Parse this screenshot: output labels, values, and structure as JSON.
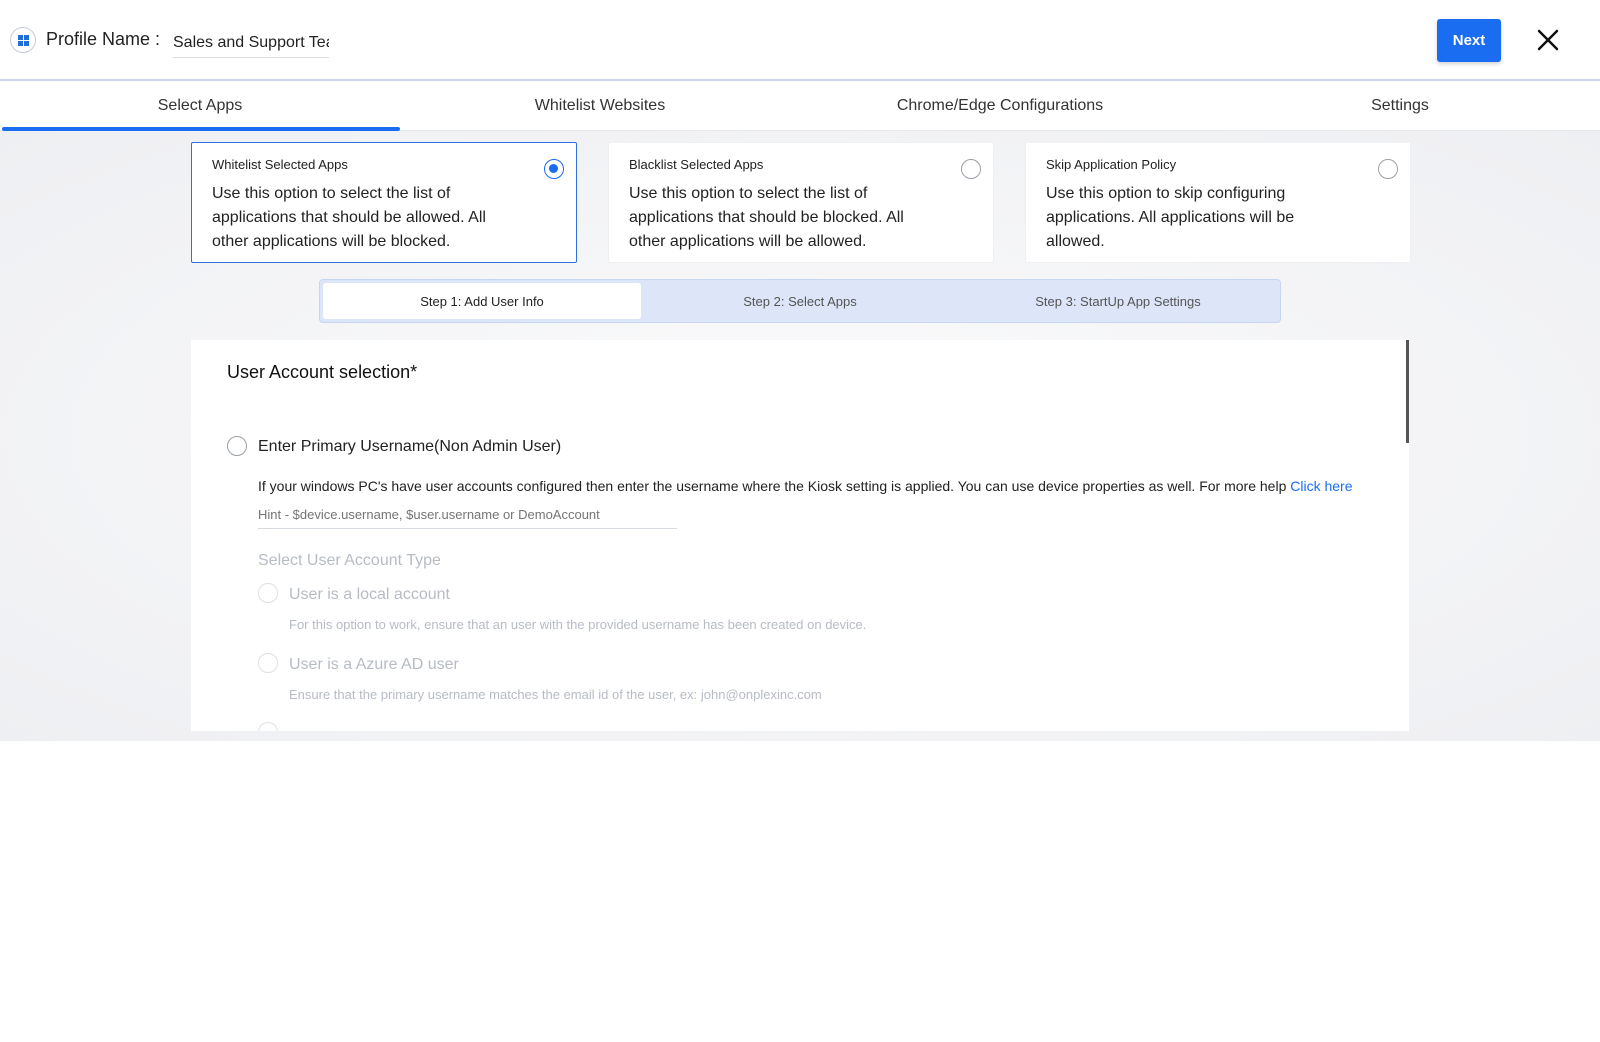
{
  "header": {
    "profile_label": "Profile Name :",
    "profile_value": "Sales and Support Tea",
    "next_label": "Next"
  },
  "tabs": [
    {
      "label": "Select Apps",
      "active": true
    },
    {
      "label": "Whitelist Websites",
      "active": false
    },
    {
      "label": "Chrome/Edge Configurations",
      "active": false
    },
    {
      "label": "Settings",
      "active": false
    }
  ],
  "policy_options": [
    {
      "title": "Whitelist Selected Apps",
      "desc": "Use this option to select the list of applications that should be allowed. All other applications will be blocked.",
      "selected": true
    },
    {
      "title": "Blacklist Selected Apps",
      "desc": "Use this option to select the list of applications that should be blocked. All other applications will be allowed.",
      "selected": false
    },
    {
      "title": "Skip Application Policy",
      "desc": "Use this option to skip configuring applications. All applications will be allowed.",
      "selected": false
    }
  ],
  "steps": [
    {
      "label": "Step 1: Add User Info",
      "active": true
    },
    {
      "label": "Step 2: Select Apps",
      "active": false
    },
    {
      "label": "Step 3: StartUp App Settings",
      "active": false
    }
  ],
  "form": {
    "section_title": "User Account selection*",
    "primary_option_label": "Enter Primary Username(Non Admin User)",
    "primary_help": "If your windows PC's have user accounts configured then enter the username where the Kiosk setting is applied. You can use device properties as well. For more help",
    "primary_help_link": "Click here",
    "username_placeholder": "Hint - $device.username, $user.username or DemoAccount",
    "account_type_title": "Select User Account Type",
    "account_types": [
      {
        "label": "User is a local account",
        "help": "For this option to work, ensure that an user with the provided username has been created on device."
      },
      {
        "label": "User is a Azure AD user",
        "help": "Ensure that the primary username matches the email id of the user, ex: john@onplexinc.com"
      }
    ]
  },
  "colors": {
    "accent": "#1a6df0",
    "tab_underline": "#1a6df0"
  }
}
